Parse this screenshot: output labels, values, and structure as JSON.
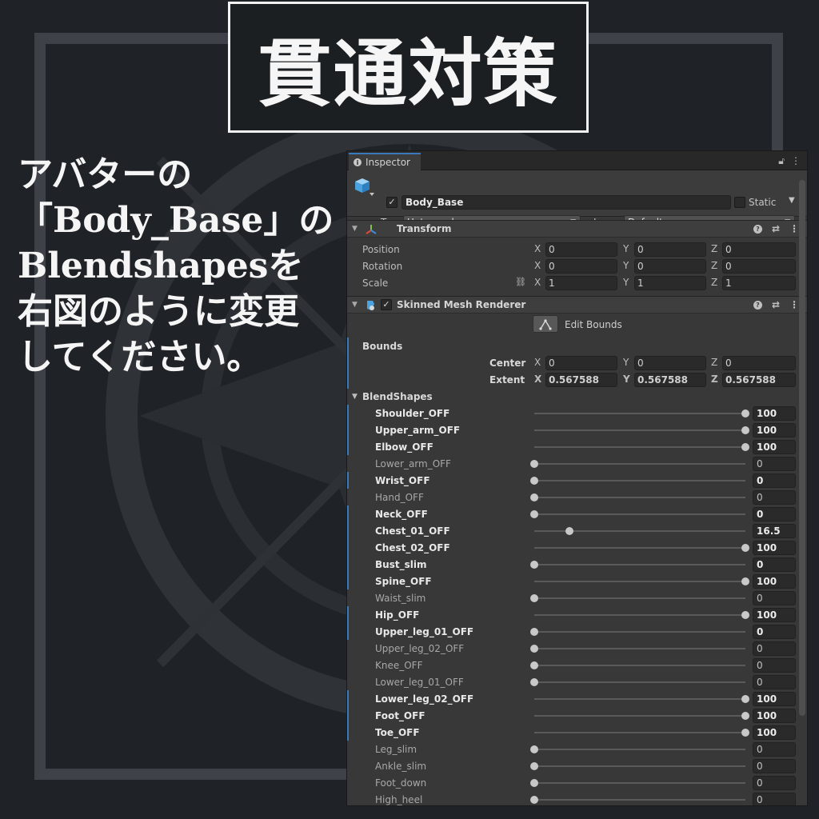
{
  "title": "貫通対策",
  "instructions": [
    "アバターの",
    "「Body_Base」の",
    "Blendshapesを",
    "右図のように変更",
    "してください。"
  ],
  "inspector": {
    "tab_label": "Inspector",
    "object": {
      "active": true,
      "name": "Body_Base",
      "static_label": "Static",
      "tag_label": "Tag",
      "tag_value": "Untagged",
      "layer_label": "Layer",
      "layer_value": "Default"
    },
    "transform": {
      "title": "Transform",
      "rows": [
        {
          "label": "Position",
          "x": "0",
          "y": "0",
          "z": "0"
        },
        {
          "label": "Rotation",
          "x": "0",
          "y": "0",
          "z": "0"
        },
        {
          "label": "Scale",
          "x": "1",
          "y": "1",
          "z": "1"
        }
      ]
    },
    "smr": {
      "title": "Skinned Mesh Renderer",
      "enabled": true,
      "edit_bounds": "Edit Bounds",
      "bounds_label": "Bounds",
      "center_label": "Center",
      "center": {
        "x": "0",
        "y": "0",
        "z": "0"
      },
      "extent_label": "Extent",
      "extent": {
        "x": "0.567588",
        "y": "0.567588",
        "z": "0.567588"
      },
      "blendshapes_label": "BlendShapes",
      "blendshapes": [
        {
          "name": "Shoulder_OFF",
          "value": "100",
          "fraction": 1.0,
          "modified": true
        },
        {
          "name": "Upper_arm_OFF",
          "value": "100",
          "fraction": 1.0,
          "modified": true
        },
        {
          "name": "Elbow_OFF",
          "value": "100",
          "fraction": 1.0,
          "modified": true
        },
        {
          "name": "Lower_arm_OFF",
          "value": "0",
          "fraction": 0.0,
          "modified": false
        },
        {
          "name": "Wrist_OFF",
          "value": "0",
          "fraction": 0.0,
          "modified": true
        },
        {
          "name": "Hand_OFF",
          "value": "0",
          "fraction": 0.0,
          "modified": false
        },
        {
          "name": "Neck_OFF",
          "value": "0",
          "fraction": 0.0,
          "modified": true
        },
        {
          "name": "Chest_01_OFF",
          "value": "16.5",
          "fraction": 0.165,
          "modified": true
        },
        {
          "name": "Chest_02_OFF",
          "value": "100",
          "fraction": 1.0,
          "modified": true
        },
        {
          "name": "Bust_slim",
          "value": "0",
          "fraction": 0.0,
          "modified": true
        },
        {
          "name": "Spine_OFF",
          "value": "100",
          "fraction": 1.0,
          "modified": true
        },
        {
          "name": "Waist_slim",
          "value": "0",
          "fraction": 0.0,
          "modified": false
        },
        {
          "name": "Hip_OFF",
          "value": "100",
          "fraction": 1.0,
          "modified": true
        },
        {
          "name": "Upper_leg_01_OFF",
          "value": "0",
          "fraction": 0.0,
          "modified": true
        },
        {
          "name": "Upper_leg_02_OFF",
          "value": "0",
          "fraction": 0.0,
          "modified": false
        },
        {
          "name": "Knee_OFF",
          "value": "0",
          "fraction": 0.0,
          "modified": false
        },
        {
          "name": "Lower_leg_01_OFF",
          "value": "0",
          "fraction": 0.0,
          "modified": false
        },
        {
          "name": "Lower_leg_02_OFF",
          "value": "100",
          "fraction": 1.0,
          "modified": true
        },
        {
          "name": "Foot_OFF",
          "value": "100",
          "fraction": 1.0,
          "modified": true
        },
        {
          "name": "Toe_OFF",
          "value": "100",
          "fraction": 1.0,
          "modified": true
        },
        {
          "name": "Leg_slim",
          "value": "0",
          "fraction": 0.0,
          "modified": false
        },
        {
          "name": "Ankle_slim",
          "value": "0",
          "fraction": 0.0,
          "modified": false
        },
        {
          "name": "Foot_down",
          "value": "0",
          "fraction": 0.0,
          "modified": false
        },
        {
          "name": "High_heel",
          "value": "0",
          "fraction": 0.0,
          "modified": false
        }
      ]
    }
  },
  "colors": {
    "background": "#1f2226",
    "panel": "#383838",
    "accent_blue": "#3a79bb",
    "transform_icon_red": "#e04a3a",
    "transform_icon_green": "#7fc34a",
    "transform_icon_blue": "#3d8be0"
  },
  "icons": {
    "object": "cube-icon",
    "transform": "transform-axes-icon",
    "smr": "skinned-mesh-icon",
    "help": "help-icon",
    "presets": "sliders-icon",
    "menu": "kebab-menu-icon",
    "lock": "lock-icon",
    "link": "constrain-proportions-icon",
    "edit_bounds": "edit-bounds-icon"
  }
}
